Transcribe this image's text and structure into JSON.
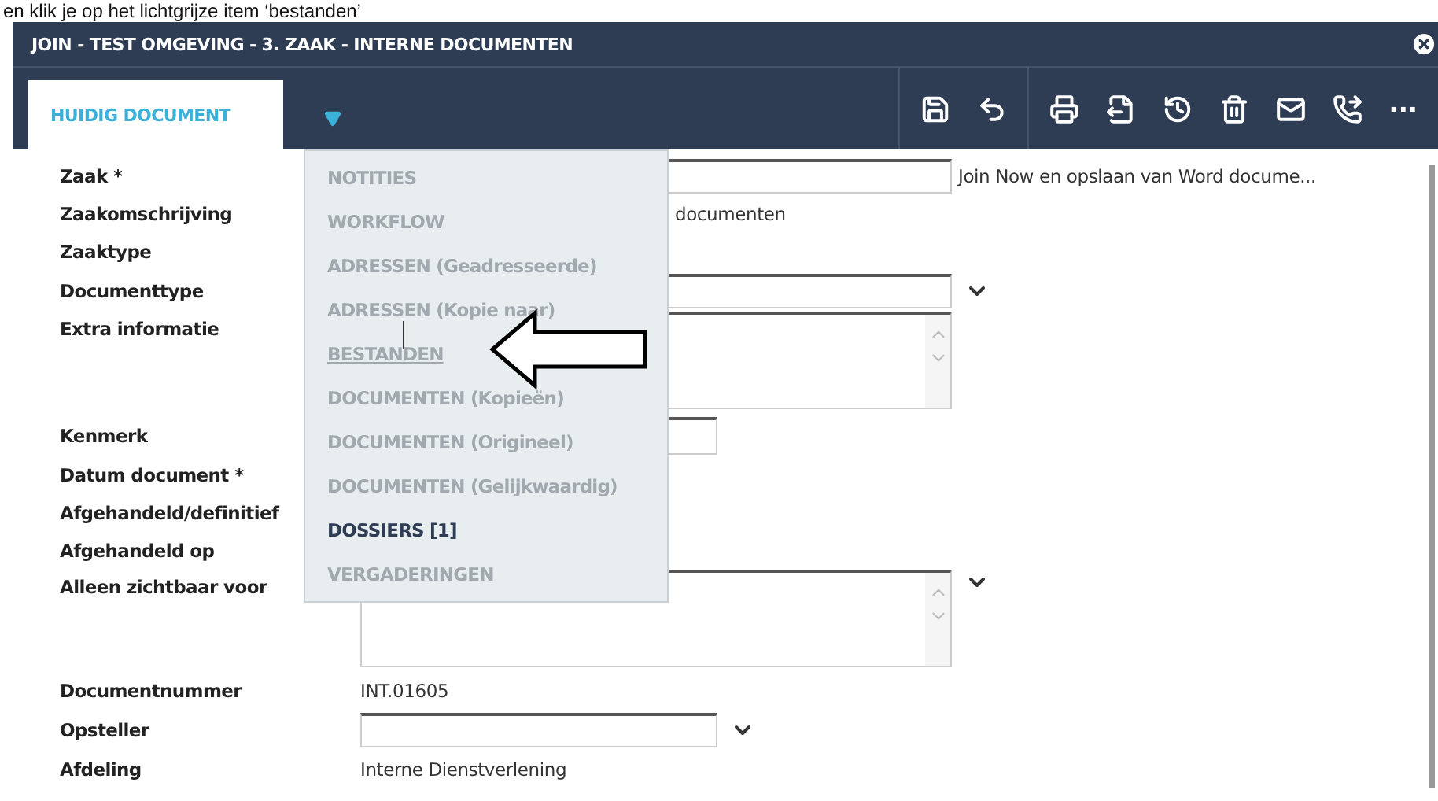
{
  "caption": "en klik je op het lichtgrijze item ‘bestanden’",
  "window": {
    "title": "JOIN - TEST OMGEVING - 3. ZAAK - INTERNE DOCUMENTEN"
  },
  "tabs": [
    {
      "label": "HUIDIG DOCUMENT",
      "selected": true
    }
  ],
  "toolbar": {
    "more": "..."
  },
  "form": [
    {
      "kind": "input",
      "label": "Zaak *",
      "side_text": "Join Now en opslaan van Word docume..."
    },
    {
      "kind": "covered-text",
      "label": "Zaakomschrijving",
      "value": "documenten"
    },
    {
      "kind": "text",
      "label": "Zaaktype"
    },
    {
      "kind": "select",
      "label": "Documenttype"
    },
    {
      "kind": "textarea",
      "label": "Extra informatie"
    },
    {
      "kind": "short-input",
      "label": "Kenmerk"
    },
    {
      "kind": "text",
      "label": "Datum document *"
    },
    {
      "kind": "text",
      "label": "Afgehandeld/definitief"
    },
    {
      "kind": "text",
      "label": "Afgehandeld op"
    },
    {
      "kind": "textarea-select",
      "label": "Alleen zichtbaar voor"
    },
    {
      "kind": "text",
      "label": "Documentnummer",
      "value": "INT.01605"
    },
    {
      "kind": "short-select",
      "label": "Opsteller"
    },
    {
      "kind": "text",
      "label": "Afdeling",
      "value": "Interne Dienstverlening"
    }
  ],
  "menu": [
    {
      "label": "NOTITIES",
      "disabled": true,
      "hovered": false
    },
    {
      "label": "WORKFLOW",
      "disabled": true,
      "hovered": false
    },
    {
      "label": "ADRESSEN (Geadresseerde)",
      "disabled": true,
      "hovered": false
    },
    {
      "label": "ADRESSEN (Kopie naar)",
      "disabled": true,
      "hovered": false
    },
    {
      "label": "BESTANDEN",
      "disabled": true,
      "hovered": true
    },
    {
      "label": "DOCUMENTEN (Kopieën)",
      "disabled": true,
      "hovered": false
    },
    {
      "label": "DOCUMENTEN (Origineel)",
      "disabled": true,
      "hovered": false
    },
    {
      "label": "DOCUMENTEN (Gelijkwaardig)",
      "disabled": true,
      "hovered": false
    },
    {
      "label": "DOSSIERS [1]",
      "disabled": false,
      "hovered": false
    },
    {
      "label": "VERGADERINGEN",
      "disabled": true,
      "hovered": false
    }
  ]
}
